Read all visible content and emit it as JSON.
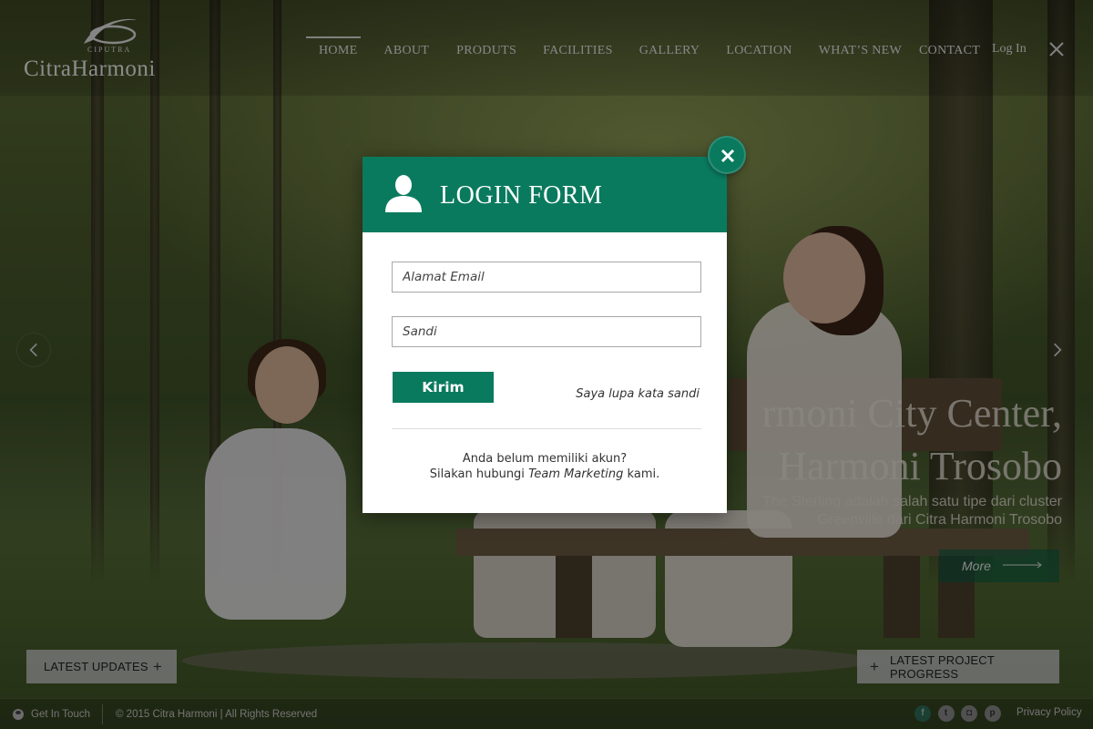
{
  "brand": {
    "logo_small": "CIPUTRA",
    "logo_main": "CitraHarmoni"
  },
  "nav": {
    "items": [
      {
        "label": "HOME",
        "active": true
      },
      {
        "label": "ABOUT"
      },
      {
        "label": "PRODUTS"
      },
      {
        "label": "FACILITIES"
      },
      {
        "label": "GALLERY"
      },
      {
        "label": "LOCATION"
      },
      {
        "label": "WHAT’S NEW"
      },
      {
        "label": "CONTACT"
      }
    ],
    "login": "Log In",
    "close_icon": "close-icon"
  },
  "hero": {
    "title": "rmoni City Center,\nHarmoni Trosobo",
    "subtitle": "The Sterling adalah salah satu tipe dari cluster Greenville dari Citra Harmoni Trosobo",
    "more_label": "More"
  },
  "bottom": {
    "updates_label": "LATEST UPDATES",
    "progress_label": "LATEST PROJECT PROGRESS"
  },
  "footer": {
    "get_in_touch": "Get In Touch",
    "copyright": "© 2015 Citra Harmoni | All Rights Reserved",
    "socials": [
      "facebook-icon",
      "twitter-icon",
      "instagram-icon",
      "pinterest-icon"
    ],
    "privacy": "Privacy Policy"
  },
  "modal": {
    "title": "LOGIN FORM",
    "email_placeholder": "Alamat Email",
    "password_placeholder": "Sandi",
    "submit_label": "Kirim",
    "forgot_label": "Saya lupa kata sandi",
    "no_account_line1": "Anda belum memiliki akun?",
    "no_account_pre": "Silakan hubungi ",
    "no_account_em": "Team Marketing",
    "no_account_post": " kami."
  },
  "colors": {
    "accent": "#0a7a5e"
  }
}
